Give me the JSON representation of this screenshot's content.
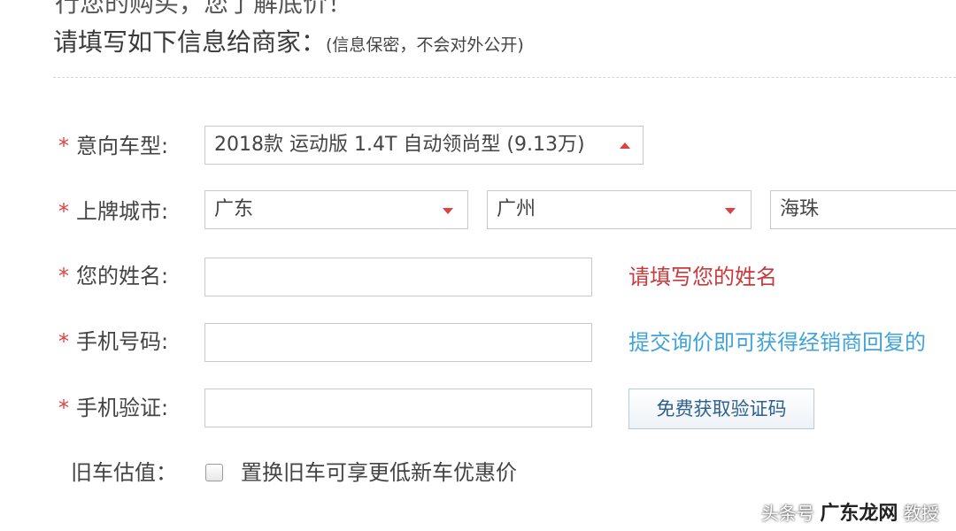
{
  "header": {
    "cut_line": "行您的购买，您了解底价！",
    "title": "请填写如下信息给商家：",
    "note": "(信息保密，不会对外公开)"
  },
  "form": {
    "car_model": {
      "label": "意向车型:",
      "value": "2018款 运动版 1.4T 自动领尚型 (9.13万)"
    },
    "city": {
      "label": "上牌城市:",
      "province": "广东",
      "city": "广州",
      "district": "海珠"
    },
    "name": {
      "label": "您的姓名:",
      "value": "",
      "hint": "请填写您的姓名"
    },
    "phone": {
      "label": "手机号码:",
      "value": "",
      "hint": "提交询价即可获得经销商回复的"
    },
    "verify": {
      "label": "手机验证:",
      "value": "",
      "button": "免费获取验证码"
    },
    "trade_in": {
      "label": "旧车估值：",
      "checked": false,
      "checkbox_label": "置换旧车可享更低新车优惠价"
    }
  },
  "required_mark": "*",
  "watermark": {
    "left": "头条号",
    "logo": "广东龙网",
    "right": "教授"
  },
  "colors": {
    "required": "#e04040",
    "hint_error": "#c8393b",
    "hint_info": "#3fa3d8",
    "button_text": "#2d5f8f"
  },
  "icons": {
    "dropdown_up": "caret-up-icon",
    "dropdown_down": "caret-down-icon"
  }
}
